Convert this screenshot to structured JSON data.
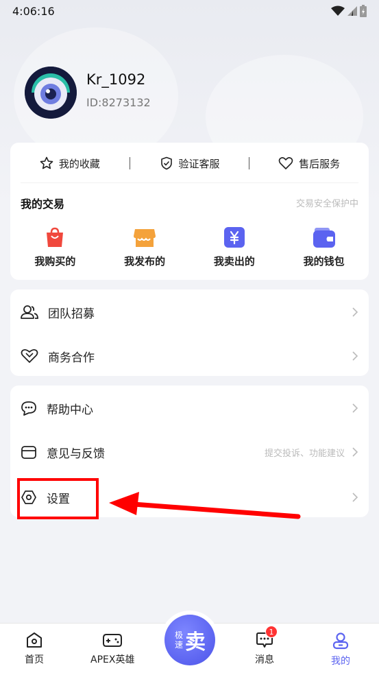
{
  "status_bar": {
    "time": "4:06:16"
  },
  "profile": {
    "username": "Kr_1092",
    "user_id": "ID:8273132"
  },
  "quick_links": [
    {
      "label": "我的收藏",
      "icon": "star-icon"
    },
    {
      "label": "验证客服",
      "icon": "shield-check-icon"
    },
    {
      "label": "售后服务",
      "icon": "heart-icon"
    }
  ],
  "trade": {
    "title": "我的交易",
    "note": "交易安全保护中",
    "items": [
      {
        "label": "我购买的",
        "icon": "shopping-bag-icon",
        "color": "#f0483d"
      },
      {
        "label": "我发布的",
        "icon": "shop-icon",
        "color": "#f4a23b"
      },
      {
        "label": "我卖出的",
        "icon": "yuan-icon",
        "color": "#5b63f0"
      },
      {
        "label": "我的钱包",
        "icon": "wallet-icon",
        "color": "#5b63f0"
      }
    ]
  },
  "menu_group_1": [
    {
      "label": "团队招募",
      "icon": "team-icon"
    },
    {
      "label": "商务合作",
      "icon": "handshake-icon"
    }
  ],
  "menu_group_2": [
    {
      "label": "帮助中心",
      "icon": "chat-help-icon",
      "hint": ""
    },
    {
      "label": "意见与反馈",
      "icon": "feedback-icon",
      "hint": "提交投诉、功能建议"
    },
    {
      "label": "设置",
      "icon": "settings-hex-icon",
      "hint": ""
    }
  ],
  "tabbar": {
    "home": "首页",
    "apex": "APEX英雄",
    "fab_small": "极速",
    "fab_big": "卖",
    "messages": "消息",
    "messages_badge": "1",
    "mine": "我的"
  },
  "colors": {
    "accent": "#5b63f0",
    "annotation": "#ff0000"
  }
}
